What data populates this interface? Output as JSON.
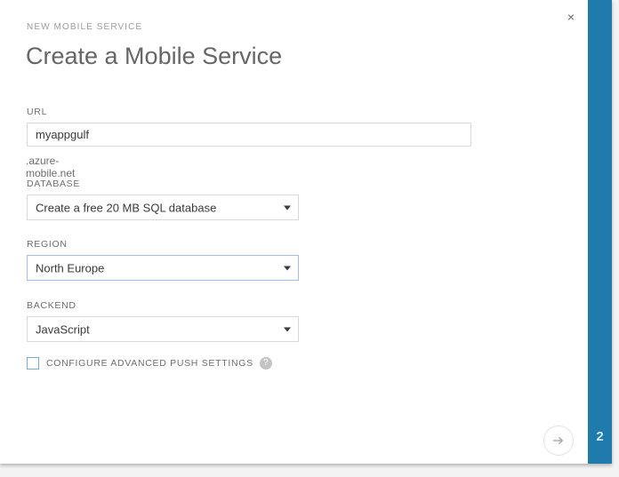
{
  "dialog": {
    "eyebrow": "NEW MOBILE SERVICE",
    "title": "Create a Mobile Service",
    "close_label": "×",
    "step_number": "2",
    "accent_color": "#1e7bab",
    "focus_border_color": "#a8bedb"
  },
  "fields": {
    "url": {
      "label": "URL",
      "value": "myappgulf",
      "placeholder": "",
      "suffix": ".azure-mobile.net"
    },
    "database": {
      "label": "DATABASE",
      "value": "Create a free 20 MB SQL database",
      "caret_icon": "chevron-down-icon"
    },
    "region": {
      "label": "REGION",
      "value": "North Europe",
      "caret_icon": "chevron-down-icon"
    },
    "backend": {
      "label": "BACKEND",
      "value": "JavaScript",
      "caret_icon": "chevron-down-icon"
    },
    "advanced_push": {
      "label": "CONFIGURE ADVANCED PUSH SETTINGS",
      "checked": false,
      "help_icon": "question-mark-icon",
      "help_glyph": "?"
    }
  },
  "actions": {
    "next": {
      "name": "next-arrow-button",
      "icon": "arrow-right-icon"
    }
  }
}
